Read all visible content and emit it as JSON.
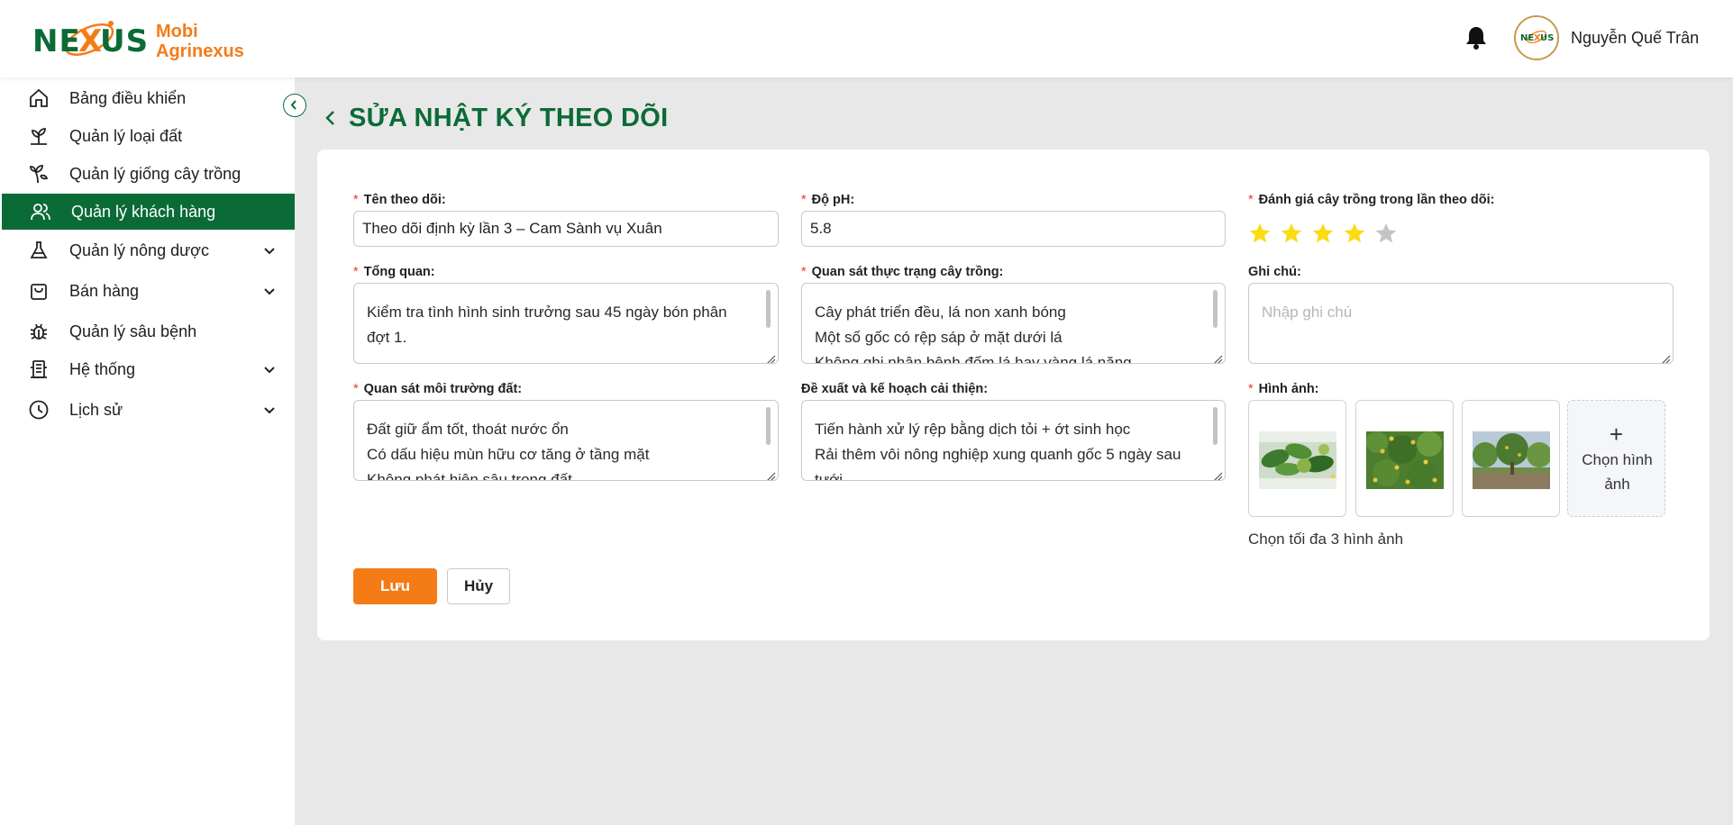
{
  "header": {
    "brand_line1": "Mobi",
    "brand_line2": "Agrinexus",
    "logo_text": "NEXUS",
    "user_name": "Nguyễn Quế Trân",
    "icons": {
      "notifications": "bell-icon",
      "avatar": "nexus-logo-avatar"
    }
  },
  "sidebar": {
    "items": [
      {
        "label": "Bảng điều khiển",
        "icon": "home-icon",
        "has_submenu": false,
        "active": false
      },
      {
        "label": "Quản lý loại đất",
        "icon": "soil-sprout-icon",
        "has_submenu": false,
        "active": false
      },
      {
        "label": "Quản lý giống cây trồng",
        "icon": "plant-icon",
        "has_submenu": false,
        "active": false
      },
      {
        "label": "Quản lý khách hàng",
        "icon": "users-icon",
        "has_submenu": false,
        "active": true
      },
      {
        "label": "Quản lý nông dược",
        "icon": "flask-icon",
        "has_submenu": true,
        "active": false
      },
      {
        "label": "Bán hàng",
        "icon": "shopping-bag-icon",
        "has_submenu": true,
        "active": false
      },
      {
        "label": "Quản lý sâu bệnh",
        "icon": "bug-icon",
        "has_submenu": false,
        "active": false
      },
      {
        "label": "Hệ thống",
        "icon": "building-icon",
        "has_submenu": true,
        "active": false
      },
      {
        "label": "Lịch sử",
        "icon": "clock-icon",
        "has_submenu": true,
        "active": false
      }
    ],
    "active_color": "#0b6b37"
  },
  "page": {
    "title": "SỬA NHẬT KÝ THEO DÕI"
  },
  "form": {
    "tracking_name": {
      "label": "Tên theo dõi:",
      "value": "Theo dõi định kỳ lần 3 – Cam Sành vụ Xuân",
      "required": true
    },
    "ph": {
      "label": "Độ pH:",
      "value": "5.8",
      "required": true
    },
    "rating": {
      "label": "Đánh giá cây trồng trong lần theo dõi:",
      "value": 4,
      "max": 5,
      "required": true
    },
    "overview": {
      "label": "Tổng quan:",
      "lines": [
        "Kiểm tra tình hình sinh trưởng sau 45 ngày bón phân",
        "đợt  1."
      ],
      "required": true
    },
    "crop_observation": {
      "label": "Quan sát thực trạng cây trồng:",
      "lines": [
        "Cây phát triển đều, lá non xanh bóng",
        "Một số gốc có rệp sáp ở mặt dưới lá",
        "Không ghi nhận bệnh đốm lá hay vàng lá năng"
      ],
      "required": true
    },
    "notes": {
      "label": "Ghi chú:",
      "placeholder": "Nhập ghi chú",
      "required": false
    },
    "soil_observation": {
      "label": "Quan sát môi trường đất:",
      "lines": [
        "Đất giữ ẩm tốt, thoát nước ổn",
        "Có dấu hiệu mùn hữu cơ tăng ở tầng mặt",
        "Không phát hiện sâu trong đất"
      ],
      "required": true
    },
    "improvement_plan": {
      "label": "Đề xuất và kế hoạch cải thiện:",
      "lines": [
        "Tiến hành xử lý rệp bằng dịch tỏi + ớt sinh học",
        "Rải thêm vôi nông nghiệp xung quanh gốc 5 ngày sau",
        "tưới"
      ],
      "required": false
    },
    "images": {
      "label": "Hình ảnh:",
      "required": true,
      "items": [
        "citrus-leaves-photo",
        "orange-tree-photo",
        "orchard-tree-photo"
      ],
      "upload_plus": "+",
      "upload_label": "Chọn hình ảnh",
      "hint": "Chọn tối đa 3 hình ảnh"
    }
  },
  "actions": {
    "save_label": "Lưu",
    "cancel_label": "Hủy"
  },
  "colors": {
    "primary_green": "#0b6b37",
    "accent_orange": "#f47c17",
    "star_filled": "#fadb14",
    "star_empty": "#c4c4c4",
    "required_mark": "#e23b3b"
  }
}
